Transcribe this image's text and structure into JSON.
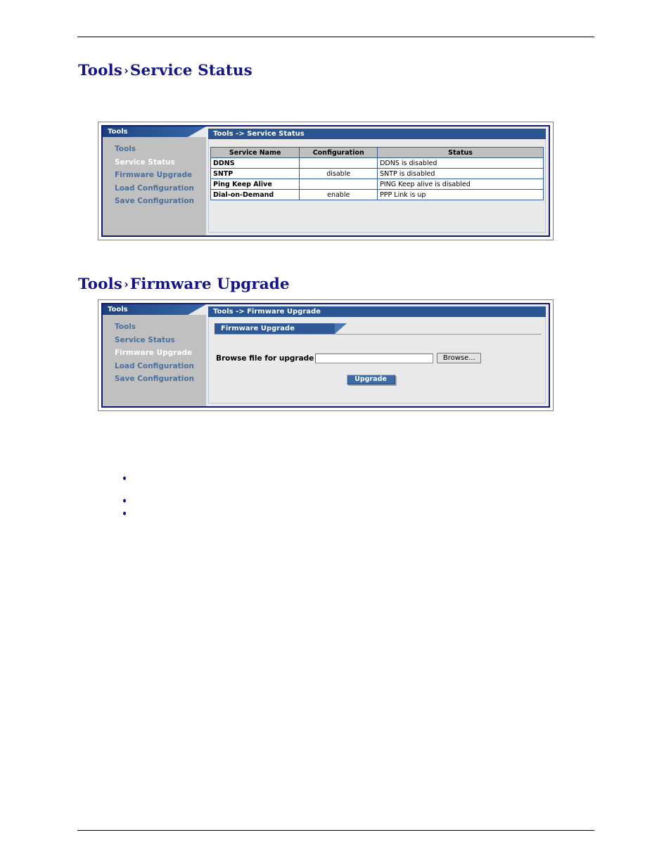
{
  "document": {
    "sections": [
      {
        "id": "service-status",
        "heading_prefix": "Tools",
        "heading_separator": "›",
        "heading_title": "Service Status"
      },
      {
        "id": "firmware-upgrade",
        "heading_prefix": "Tools",
        "heading_separator": "›",
        "heading_title": "Firmware Upgrade"
      }
    ],
    "bullets": [
      "",
      "",
      ""
    ]
  },
  "service_status_panel": {
    "nav": {
      "header_label": "Tools",
      "items": [
        {
          "label": "Tools",
          "active": false
        },
        {
          "label": "Service Status",
          "active": true
        },
        {
          "label": "Firmware Upgrade",
          "active": false
        },
        {
          "label": "Load Configuration",
          "active": false
        },
        {
          "label": "Save Configuration",
          "active": false
        }
      ]
    },
    "titlebar": "Tools  -> Service Status",
    "table": {
      "columns": [
        "Service Name",
        "Configuration",
        "Status"
      ],
      "rows": [
        {
          "service": "DDNS",
          "configuration": "",
          "status": "DDNS is disabled"
        },
        {
          "service": "SNTP",
          "configuration": "disable",
          "status": "SNTP is disabled"
        },
        {
          "service": "Ping Keep Alive",
          "configuration": "",
          "status": "PING Keep alive is disabled"
        },
        {
          "service": "Dial-on-Demand",
          "configuration": "enable",
          "status": "PPP Link is up"
        }
      ]
    }
  },
  "firmware_upgrade_panel": {
    "nav": {
      "header_label": "Tools",
      "items": [
        {
          "label": "Tools",
          "active": false
        },
        {
          "label": "Service Status",
          "active": false
        },
        {
          "label": "Firmware Upgrade",
          "active": true
        },
        {
          "label": "Load Configuration",
          "active": false
        },
        {
          "label": "Save Configuration",
          "active": false
        }
      ]
    },
    "titlebar": "Tools  -> Firmware Upgrade",
    "subtab_label": "Firmware Upgrade",
    "form": {
      "file_label": "Browse file for upgrade",
      "file_value": "",
      "file_placeholder": "",
      "browse_button": "Browse...",
      "submit_button": "Upgrade"
    }
  },
  "colors": {
    "heading": "#151585",
    "panel_border": "#131a6e",
    "titlebar_blue": "#2b5492",
    "nav_bg": "#c0c0c0",
    "content_bg": "#e9e9e9",
    "nav_link": "#4c6f9e",
    "nav_link_active": "#ffffff",
    "table_header_bg": "#bfbfbf",
    "table_border": "#2f5d9e",
    "button_blue": "#3e6ba6"
  }
}
